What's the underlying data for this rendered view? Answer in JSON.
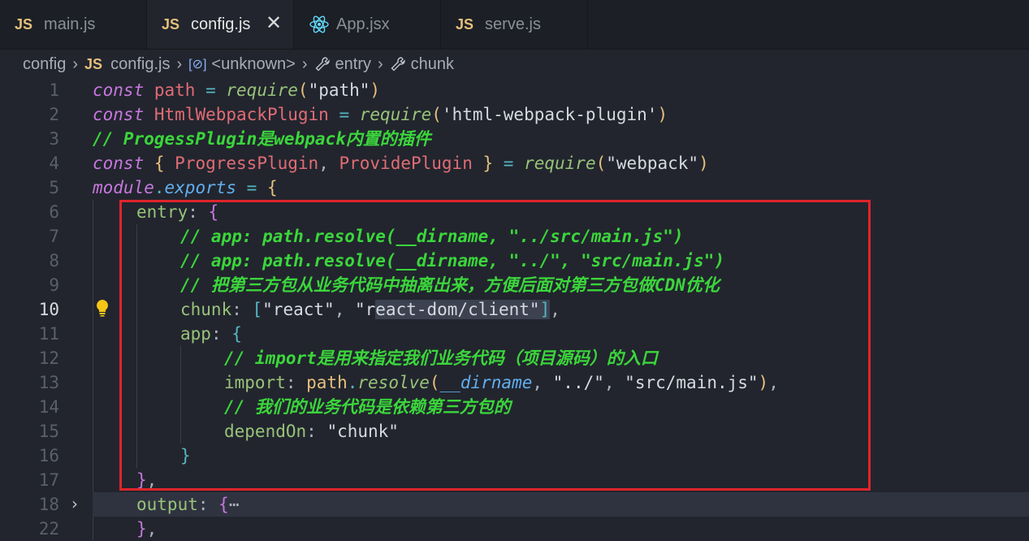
{
  "tabs": [
    {
      "icon": "JS",
      "label": "main.js",
      "active": false
    },
    {
      "icon": "JS",
      "label": "config.js",
      "active": true,
      "close": "✕"
    },
    {
      "icon": "react-icon",
      "label": "App.jsx",
      "active": false
    },
    {
      "icon": "JS",
      "label": "serve.js",
      "active": false
    }
  ],
  "breadcrumb": {
    "folder": "config",
    "file_icon": "JS",
    "file": "config.js",
    "sym1": "<unknown>",
    "sym2": "entry",
    "sym3": "chunk"
  },
  "editor": {
    "line_numbers": [
      "1",
      "2",
      "3",
      "4",
      "5",
      "6",
      "7",
      "8",
      "9",
      "10",
      "11",
      "12",
      "13",
      "14",
      "15",
      "16",
      "17",
      "18",
      "22"
    ],
    "current_line": "10",
    "lines": {
      "l1": {
        "a": "const",
        "b": "path",
        "c": " = ",
        "d": "require",
        "e": "(",
        "f": "\"path\"",
        "g": ")"
      },
      "l2": {
        "a": "const",
        "b": "HtmlWebpackPlugin",
        "c": " = ",
        "d": "require",
        "e": "(",
        "f": "'html-webpack-plugin'",
        "g": ")"
      },
      "l3": "// ProgessPlugin是webpack内置的插件",
      "l4": {
        "a": "const",
        "b": "{ ",
        "c": "ProgressPlugin",
        "d": ", ",
        "e": "ProvidePlugin",
        "f": " }",
        "g": " = ",
        "h": "require",
        "i": "(",
        "j": "\"webpack\"",
        "k": ")"
      },
      "l5": {
        "a": "module",
        "b": ".",
        "c": "exports",
        "d": " = ",
        "e": "{"
      },
      "l6": {
        "a": "entry",
        "b": ": ",
        "c": "{"
      },
      "l7": "// app: path.resolve(__dirname, \"../src/main.js\")",
      "l8": "// app: path.resolve(__dirname, \"../\", \"src/main.js\")",
      "l9": "// 把第三方包从业务代码中抽离出来，方便后面对第三方包做CDN优化",
      "l10": {
        "a": "chunk",
        "b": ": ",
        "c": "[",
        "d": "\"react\"",
        "e": ", ",
        "f": "\"r",
        "g": "eact-dom/client\"",
        "h": "]",
        "i": ","
      },
      "l11": {
        "a": "app",
        "b": ": ",
        "c": "{"
      },
      "l12": "// import是用来指定我们业务代码（项目源码）的入口",
      "l13": {
        "a": "import",
        "b": ": ",
        "c": "path",
        "d": ".",
        "e": "resolve",
        "f": "(",
        "g": "__dirname",
        "h": ", ",
        "i": "\"../\"",
        "j": ", ",
        "k": "\"src/main.js\"",
        "l": ")",
        "m": ","
      },
      "l14": "// 我们的业务代码是依赖第三方包的",
      "l15": {
        "a": "dependOn",
        "b": ": ",
        "c": "\"chunk\""
      },
      "l16": "}",
      "l17": {
        "a": "}",
        "b": ","
      },
      "l18": {
        "a": "output",
        "b": ": ",
        "c": "{",
        "d": "⋯"
      },
      "l22": {
        "a": "}",
        "b": ","
      }
    }
  },
  "colors": {
    "highlight_box": "#e0242b",
    "comment": "#3bd63b",
    "keyword": "#c678dd"
  }
}
